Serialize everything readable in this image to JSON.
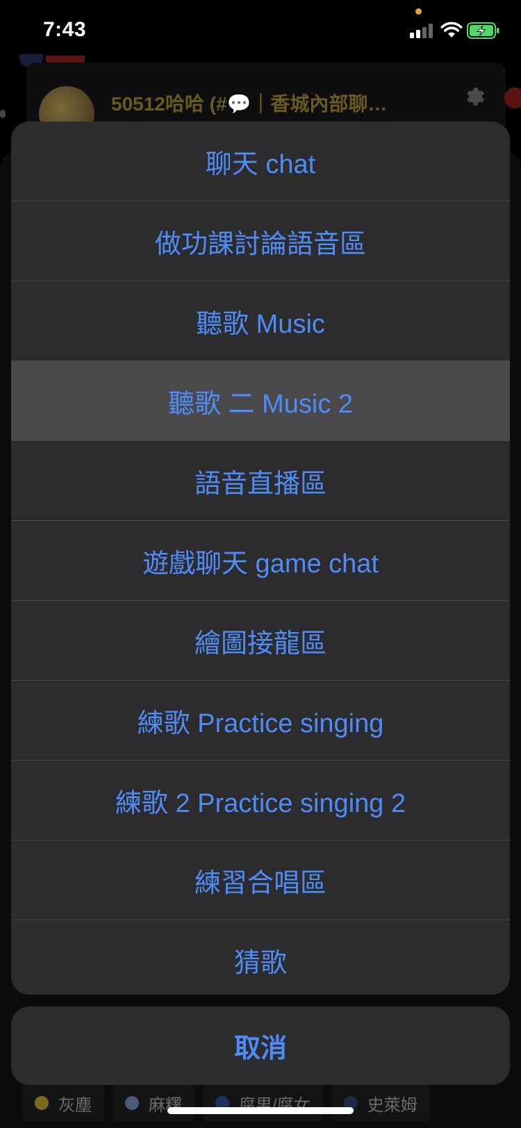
{
  "status_bar": {
    "time": "7:43",
    "icons": [
      "cellular-signal-icon",
      "wifi-icon",
      "battery-charging-icon"
    ],
    "colors": {
      "battery_fill": "#4cd964",
      "recording_dot": "#f0a040"
    }
  },
  "background": {
    "channel_title": "50512哈哈 (#💬｜香城內部聊…",
    "chips": [
      {
        "label": "灰塵",
        "color": "#7a6a20"
      },
      {
        "label": "麻糬",
        "color": "#4a5a78"
      },
      {
        "label": "腐男/腐女",
        "color": "#1e3260"
      },
      {
        "label": "史萊姆",
        "color": "#1a2a48"
      }
    ]
  },
  "action_sheet": {
    "items": [
      {
        "label": "聊天 chat"
      },
      {
        "label": "做功課討論語音區"
      },
      {
        "label": "聽歌 Music"
      },
      {
        "label": "聽歌 二 Music 2"
      },
      {
        "label": "語音直播區"
      },
      {
        "label": "遊戲聊天 game chat"
      },
      {
        "label": "繪圖接龍區"
      },
      {
        "label": "練歌 Practice singing"
      },
      {
        "label": "練歌 2 Practice singing 2"
      },
      {
        "label": "練習合唱區"
      },
      {
        "label": "猜歌"
      }
    ],
    "highlighted_index": 3,
    "cancel_label": "取消"
  },
  "theme": {
    "accent": "#4f8cf5",
    "sheet_bg": "#2c2c2e",
    "separator": "#48484a",
    "highlight_bg": "#4a4a4c"
  }
}
